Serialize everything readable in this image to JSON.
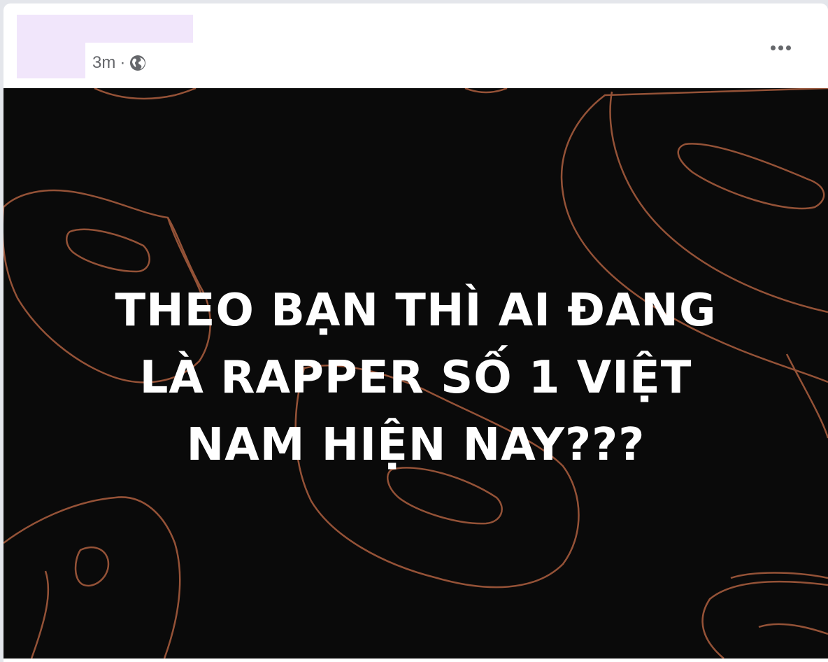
{
  "post": {
    "timestamp": "3m",
    "separator": "·",
    "privacy_icon": "globe-icon",
    "more_icon": "more-options-icon"
  },
  "image": {
    "lines": [
      "THEO BẠN THÌ AI ĐANG",
      "LÀ RAPPER SỐ 1 VIỆT",
      "NAM HIỆN NAY???"
    ],
    "background_color": "#0a0a0a",
    "outline_color": "#a45a3c"
  }
}
